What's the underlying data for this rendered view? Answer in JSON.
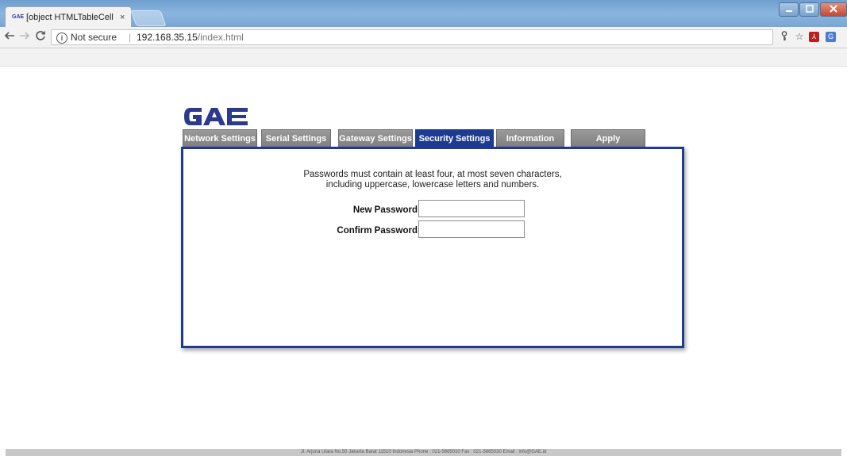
{
  "browser": {
    "tab_title": "[object HTMLTableCellEl",
    "tab_favicon": "GAE",
    "tab_close": "×",
    "security_label": "Not secure",
    "url_host": "192.168.35.15",
    "url_path": "/index.html",
    "icons": [
      "back-icon",
      "forward-icon",
      "reload-icon",
      "info-icon",
      "key-icon",
      "star-icon",
      "pdf-icon",
      "translate-icon"
    ]
  },
  "logo": {
    "text": "GAE",
    "color": "#2b3a8f"
  },
  "nav_tabs": [
    {
      "label": "Network Settings"
    },
    {
      "label": "Serial Settings"
    },
    {
      "label": "Gateway Settings"
    },
    {
      "label": "Security Settings",
      "active": true
    },
    {
      "label": "Information"
    },
    {
      "label": "Apply"
    }
  ],
  "security": {
    "notice_line1": "Passwords must contain at least four, at most seven characters,",
    "notice_line2": "including uppercase, lowercase letters and numbers.",
    "new_password_label": "New Password",
    "new_password_value": "",
    "confirm_password_label": "Confirm Password",
    "confirm_password_value": ""
  },
  "footer": {
    "text": "Jl. Arjuna Utara No.50 Jakarta Barat 11510 Indonesia Phone : 021-5665010 Fax : 021-5665030 Email : info@GAE.id"
  },
  "colors": {
    "accent": "#1d3b90",
    "tab_inactive": "#8a8a8a",
    "titlebar": "#7aa6d3"
  }
}
